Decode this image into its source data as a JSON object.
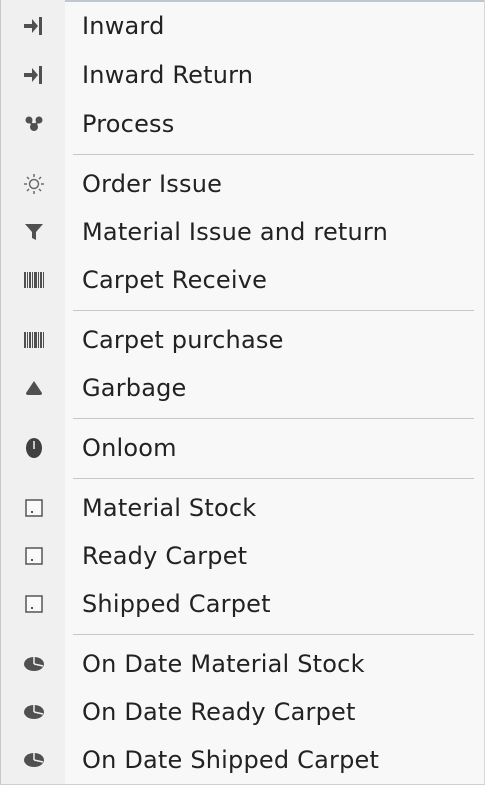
{
  "menu": {
    "items": [
      {
        "label": "Inward",
        "icon": "inward-arrow-icon"
      },
      {
        "label": "Inward Return",
        "icon": "inward-return-arrow-icon"
      },
      {
        "label": "Process",
        "icon": "process-icon"
      },
      {
        "label": "Order Issue",
        "icon": "sun-icon"
      },
      {
        "label": "Material Issue and return",
        "icon": "filter-icon"
      },
      {
        "label": "Carpet Receive",
        "icon": "barcode-icon"
      },
      {
        "label": "Carpet purchase",
        "icon": "barcode-icon"
      },
      {
        "label": "Garbage",
        "icon": "triangle-icon"
      },
      {
        "label": "Onloom",
        "icon": "circle-icon"
      },
      {
        "label": "Material Stock",
        "icon": "square-icon"
      },
      {
        "label": "Ready Carpet",
        "icon": "square-icon"
      },
      {
        "label": "Shipped Carpet",
        "icon": "square-icon"
      },
      {
        "label": "On Date Material Stock",
        "icon": "pie-chart-icon"
      },
      {
        "label": "On Date Ready Carpet",
        "icon": "pie-chart-icon"
      },
      {
        "label": "On Date Shipped Carpet",
        "icon": "pie-chart-icon"
      }
    ]
  }
}
